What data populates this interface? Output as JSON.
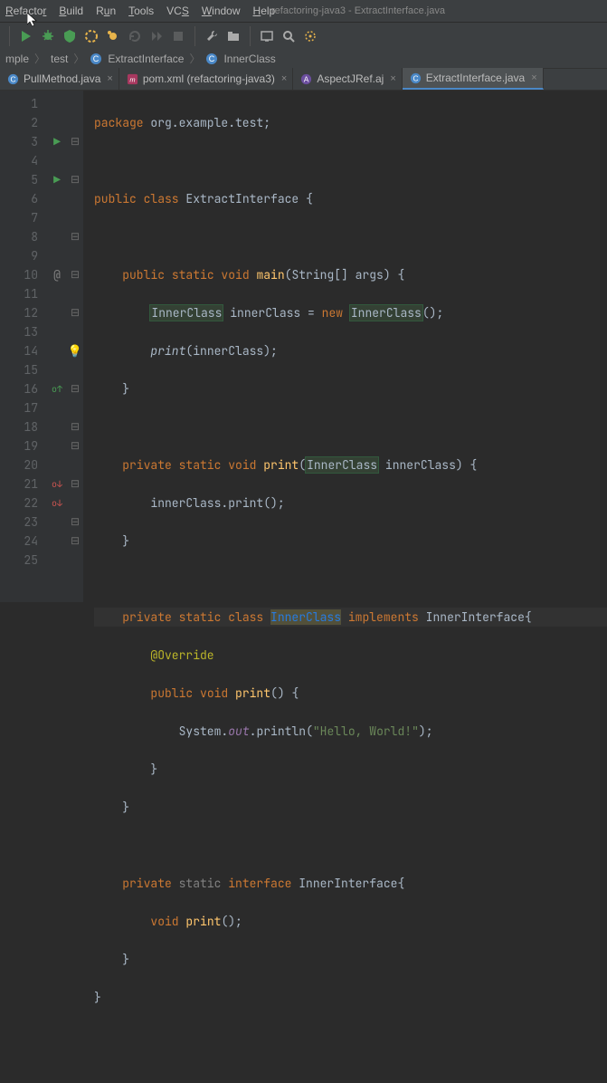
{
  "menu": {
    "refactor": "Refactor",
    "build": "Build",
    "run": "Run",
    "tools": "Tools",
    "vcs": "VCS",
    "window": "Window",
    "help": "Help"
  },
  "title": "refactoring-java3 - ExtractInterface.java",
  "breadcrumb": {
    "b0": "mple",
    "b1": "test",
    "b2": "ExtractInterface",
    "b3": "InnerClass"
  },
  "tabs": {
    "t0": "PullMethod.java",
    "t1": "pom.xml (refactoring-java3)",
    "t2": "AspectJRef.aj",
    "t3": "ExtractInterface.java"
  },
  "lines": {
    "n1": "1",
    "n2": "2",
    "n3": "3",
    "n4": "4",
    "n5": "5",
    "n6": "6",
    "n7": "7",
    "n8": "8",
    "n9": "9",
    "n10": "10",
    "n11": "11",
    "n12": "12",
    "n13": "13",
    "n14": "14",
    "n15": "15",
    "n16": "16",
    "n17": "17",
    "n18": "18",
    "n19": "19",
    "n20": "20",
    "n21": "21",
    "n22": "22",
    "n23": "23",
    "n24": "24",
    "n25": "25"
  },
  "code": {
    "pkg": "package ",
    "pkgname": "org.example.test",
    "pub": "public ",
    "cls": "class ",
    "name": "ExtractInterface",
    "ob": " {",
    "stat": "static ",
    "voi": "void ",
    "main": "main",
    "mainargs": "String[] args",
    "opar": "(",
    "cpar": ")",
    "inner": "InnerClass",
    "innerclass": "innerClass",
    "eq": " = ",
    "newkw": "new ",
    "print": "print",
    "dot": ".",
    "out": "out",
    "sys": "System",
    "println": "println",
    "hello": "\"Hello, World!\"",
    "priv": "private ",
    "impl": "implements ",
    "innerIface": "InnerInterface",
    "ovr": "@Override",
    "iface": "interface "
  }
}
